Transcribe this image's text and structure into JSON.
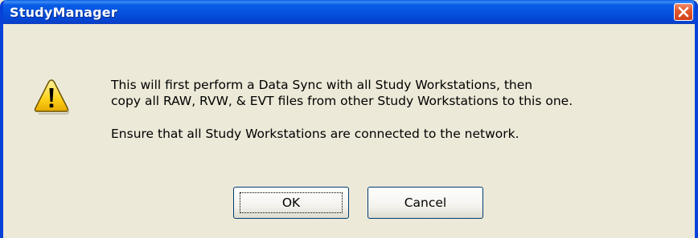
{
  "window": {
    "title": "StudyManager",
    "close_icon": "close-icon",
    "title_bar_color": "#0553e0"
  },
  "dialog": {
    "icon": "warning-icon",
    "message_lines": [
      "This will first perform a Data Sync with all Study Workstations, then",
      "copy all RAW, RVW, & EVT files from other Study Workstations to this one.",
      "Ensure that all Study Workstations are connected to the network."
    ],
    "buttons": {
      "ok_label": "OK",
      "cancel_label": "Cancel"
    }
  }
}
